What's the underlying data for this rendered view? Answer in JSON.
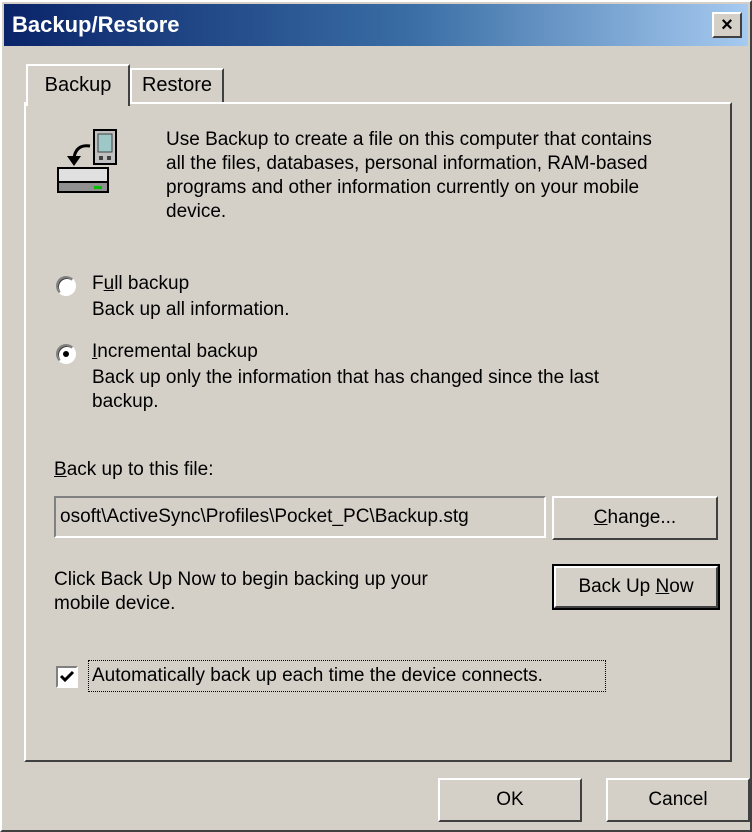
{
  "window": {
    "title": "Backup/Restore",
    "close_label": "×"
  },
  "tabs": [
    {
      "label": "Backup",
      "selected": true
    },
    {
      "label": "Restore",
      "selected": false
    }
  ],
  "description": [
    "Use Backup to create a file on this computer that contains",
    "all the files, databases, personal information, RAM-based",
    "programs and other information currently on your mobile",
    "device."
  ],
  "options": {
    "full": {
      "label": "Full backup",
      "mnemonic": "u",
      "description": "Back up all information.",
      "selected": false
    },
    "incremental": {
      "label": "Incremental backup",
      "mnemonic": "I",
      "description_line1": "Back up only the information that has changed since the last",
      "description_line2": "backup.",
      "selected": true
    }
  },
  "file": {
    "label": "Back up to this file:",
    "mnemonic": "B",
    "value": "osoft\\ActiveSync\\Profiles\\Pocket_PC\\Backup.stg",
    "change_label": "Change...",
    "change_mnemonic": "C"
  },
  "backup_now": {
    "text_line1": "Click Back Up Now to begin backing up your",
    "text_line2": "mobile device.",
    "button_label": "Back Up Now",
    "mnemonic": "N"
  },
  "auto_backup": {
    "label": "Automatically back up each time the device connects.",
    "checked": true
  },
  "footer": {
    "ok_label": "OK",
    "cancel_label": "Cancel"
  }
}
